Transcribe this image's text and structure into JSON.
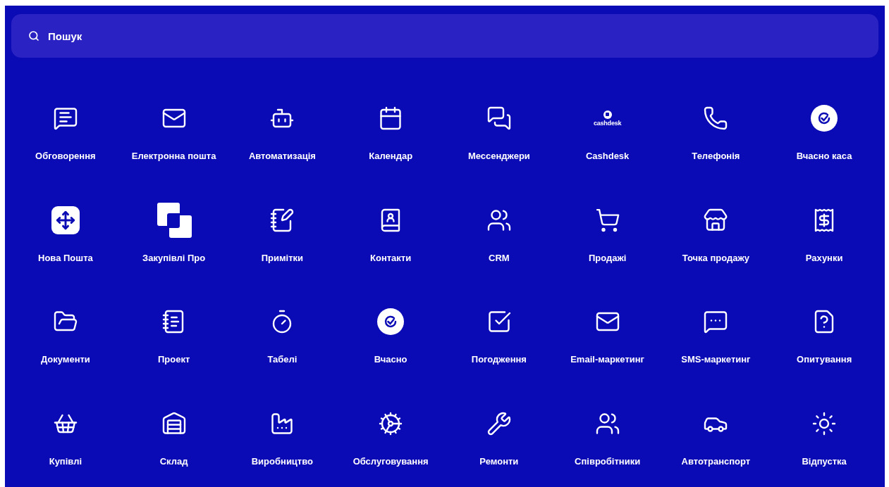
{
  "search": {
    "placeholder": "Пошук"
  },
  "apps": [
    {
      "label": "Обговорення"
    },
    {
      "label": "Електронна пошта"
    },
    {
      "label": "Автоматизація"
    },
    {
      "label": "Календар"
    },
    {
      "label": "Мессенджери"
    },
    {
      "label": "Cashdesk",
      "logo_text": "cashdesk"
    },
    {
      "label": "Телефонія"
    },
    {
      "label": "Вчасно каса"
    },
    {
      "label": "Нова Пошта"
    },
    {
      "label": "Закупівлі Про"
    },
    {
      "label": "Примітки"
    },
    {
      "label": "Контакти"
    },
    {
      "label": "CRM"
    },
    {
      "label": "Продажі"
    },
    {
      "label": "Точка продажу"
    },
    {
      "label": "Рахунки"
    },
    {
      "label": "Документи"
    },
    {
      "label": "Проект"
    },
    {
      "label": "Табелі"
    },
    {
      "label": "Вчасно"
    },
    {
      "label": "Погодження"
    },
    {
      "label": "Email-маркетинг"
    },
    {
      "label": "SMS-маркетинг"
    },
    {
      "label": "Опитування"
    },
    {
      "label": "Купівлі"
    },
    {
      "label": "Склад"
    },
    {
      "label": "Виробництво"
    },
    {
      "label": "Обслуговування"
    },
    {
      "label": "Ремонти"
    },
    {
      "label": "Співробітники"
    },
    {
      "label": "Автотранспорт"
    },
    {
      "label": "Відпустка"
    }
  ]
}
